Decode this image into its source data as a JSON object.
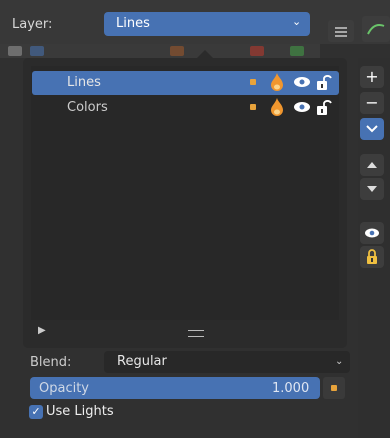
{
  "layer": {
    "label": "Layer:",
    "value": "Lines"
  },
  "layers": [
    {
      "name": "Lines",
      "selected": true
    },
    {
      "name": "Colors",
      "selected": false
    }
  ],
  "blend": {
    "label": "Blend:",
    "value": "Regular"
  },
  "opacity": {
    "label": "Opacity",
    "value": "1.000"
  },
  "use_lights": {
    "label": "Use Lights",
    "checked": true
  },
  "side_buttons": {
    "add": "+",
    "remove": "−"
  },
  "colors": {
    "accent": "#4772b3",
    "keyframe": "#e8a33b",
    "flame": "#f0962e"
  }
}
